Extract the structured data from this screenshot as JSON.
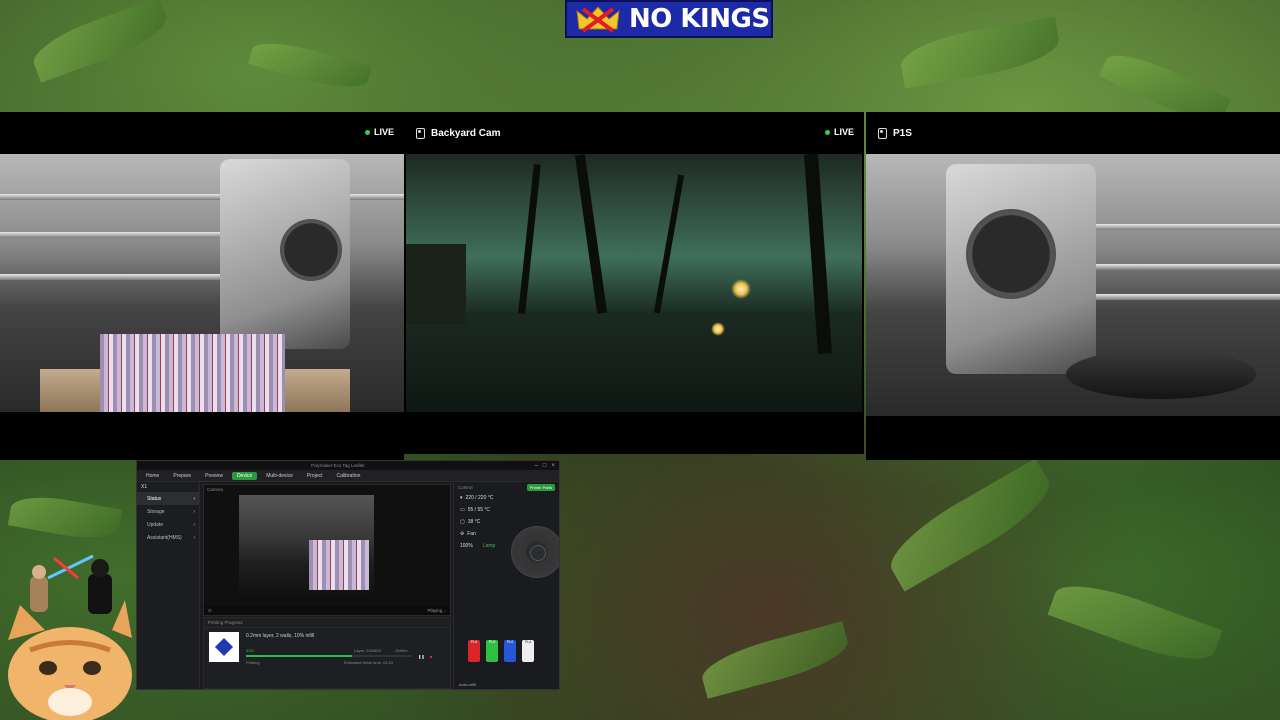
{
  "banner": {
    "text": "NO KINGS"
  },
  "cams": [
    {
      "name": "",
      "live": "LIVE"
    },
    {
      "name": "Backyard Cam",
      "live": "LIVE"
    },
    {
      "name": "P1S",
      "live": ""
    }
  ],
  "app": {
    "title": "Polymaker Eco Tag Leaflet",
    "nav": [
      "Home",
      "Prepare",
      "Preview",
      "Device",
      "Multi-device",
      "Project",
      "Calibration"
    ],
    "printer": "X1",
    "side": [
      "Status",
      "Storage",
      "Update",
      "Assistant(HMS)"
    ],
    "camera_label": "Camera",
    "playing": "Playing...",
    "progress_label": "Printing Progress",
    "print_title": "0.2mm layer, 2 walls, 10% infill",
    "percent": "63%",
    "state": "Printing",
    "layer": "Layer: 206/503",
    "remaining": "-2h05m",
    "finish": "Estimated finish time: 04:23",
    "progress": 0.64,
    "control_label": "Control",
    "parts_button": "Printer Parts",
    "temps": [
      "220 / 220 °C",
      "55 / 55 °C",
      "38 °C"
    ],
    "fan_label": "Fan",
    "speed": "100%",
    "lamp": "Lamp",
    "ams_labels": [
      "PLA",
      "PLA",
      "PLA",
      "PLA"
    ],
    "ams_colors": [
      "#d8262b",
      "#2fc043",
      "#2657d6",
      "#eeeeee"
    ],
    "auto_refill": "Auto-refill"
  }
}
